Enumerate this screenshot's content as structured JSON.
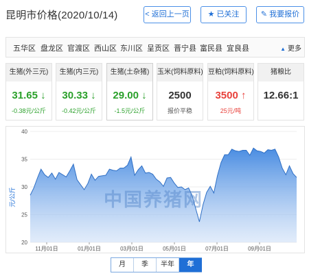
{
  "header": {
    "title": "昆明市价格(2020/10/14)",
    "back_label": "返回上一页",
    "follow_label": "已关注",
    "report_label": "我要报价"
  },
  "districts": {
    "items": [
      "五华区",
      "盘龙区",
      "官渡区",
      "西山区",
      "东川区",
      "呈贡区",
      "晋宁县",
      "富民县",
      "宜良县"
    ],
    "more_label": "更多"
  },
  "cards": [
    {
      "title": "生猪(外三元)",
      "value": "31.65",
      "trend": "down",
      "sub": "-0.38元/公斤"
    },
    {
      "title": "生猪(内三元)",
      "value": "30.33",
      "trend": "down",
      "sub": "-0.42元/公斤"
    },
    {
      "title": "生猪(土杂猪)",
      "value": "29.00",
      "trend": "down",
      "sub": "-1.5元/公斤"
    },
    {
      "title": "玉米(饲料原料)",
      "value": "2500",
      "trend": "flat",
      "sub": "报价平稳"
    },
    {
      "title": "豆粕(饲料原料)",
      "value": "3500",
      "trend": "up",
      "sub": "25元/吨"
    },
    {
      "title": "猪粮比",
      "value": "12.66:1",
      "trend": "none",
      "sub": ""
    }
  ],
  "colors": {
    "accent": "#1f6fd6",
    "down": "#2aa02a",
    "up": "#e8403a",
    "area": "#4a8fe0"
  },
  "watermark": "中国养猪网",
  "tabs": {
    "items": [
      "月",
      "季",
      "半年",
      "年"
    ],
    "active": 3
  },
  "chart_data": {
    "type": "area",
    "ylabel": "元/公斤",
    "ylim": [
      20,
      40
    ],
    "yticks": [
      20,
      25,
      30,
      35,
      40
    ],
    "xticks": [
      "11月01日",
      "01月01日",
      "03月01日",
      "05月01日",
      "07月01日",
      "09月01日"
    ],
    "grid": true,
    "series": [
      {
        "values": [
          28.5,
          29.8,
          31.6,
          33.2,
          32.2,
          31.7,
          32.5,
          31.4,
          32.6,
          32.2,
          31.8,
          32.9,
          34.1,
          31.3,
          30.4,
          29.5,
          30.6,
          32.3,
          31.2,
          31.9,
          32.0,
          32.1,
          33.2,
          33.0,
          32.9,
          33.4,
          33.4,
          33.9,
          35.4,
          32.1,
          33.1,
          33.8,
          32.5,
          32.6,
          32.3,
          31.4,
          30.9,
          30.1,
          31.6,
          31.7,
          30.7,
          29.9,
          30.0,
          29.5,
          29.8,
          28.4,
          26.0,
          23.7,
          26.8,
          29.0,
          30.1,
          28.9,
          32.0,
          34.4,
          35.8,
          35.8,
          36.8,
          36.5,
          36.4,
          36.6,
          36.6,
          35.7,
          37.0,
          36.5,
          36.4,
          36.1,
          36.7,
          36.6,
          36.8,
          35.4,
          33.4,
          32.2,
          33.8,
          32.4,
          31.7
        ]
      }
    ]
  }
}
